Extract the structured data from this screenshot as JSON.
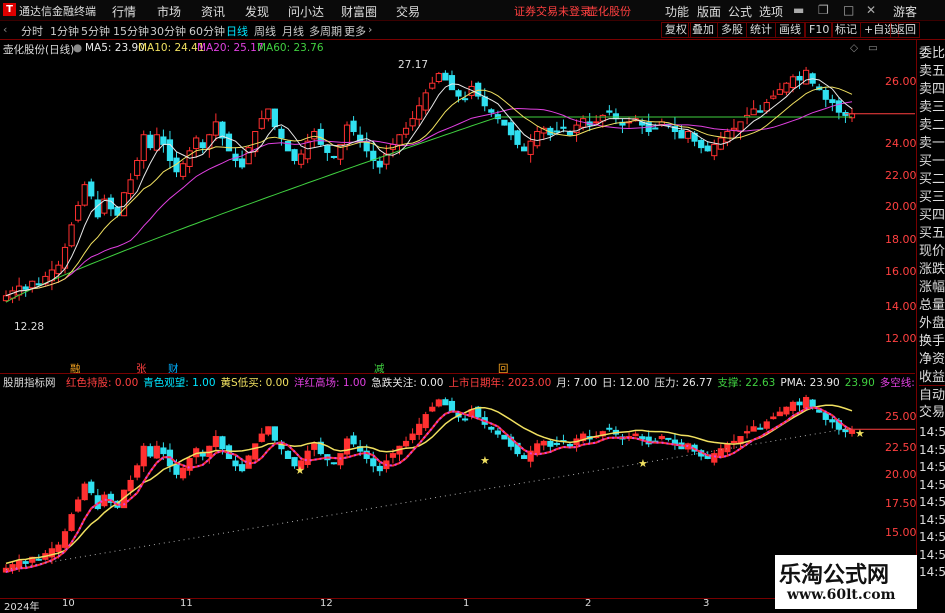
{
  "app": {
    "title": "通达信金融终端",
    "menu": [
      "行情",
      "市场",
      "资讯",
      "发现",
      "问小达",
      "财富圈",
      "交易"
    ],
    "login_notice": "证券交易未登录",
    "stock_short": "壶化股份",
    "right_menu": [
      "功能",
      "版面",
      "公式",
      "选项"
    ],
    "user": "游客"
  },
  "toolbar": {
    "periods": [
      "分时",
      "1分钟",
      "5分钟",
      "15分钟",
      "30分钟",
      "60分钟",
      "日线",
      "周线",
      "月线",
      "多周期",
      "更多"
    ],
    "active_period": "日线",
    "right_buttons": [
      "复权",
      "叠加",
      "多股",
      "统计",
      "画线",
      "F10",
      "标记",
      "+自选",
      "返回"
    ]
  },
  "main": {
    "title": "壶化股份(日线)",
    "ma": [
      {
        "label": "MA5: 23.90",
        "color": "#e8e8e8"
      },
      {
        "label": "MA10: 24.41",
        "color": "#f0e060"
      },
      {
        "label": "MA20: 25.17",
        "color": "#e040e0"
      },
      {
        "label": "MA60: 23.76",
        "color": "#40d040"
      }
    ],
    "y_ticks": [
      "26.00",
      "24.00",
      "22.00",
      "20.00",
      "18.00",
      "16.00",
      "14.00",
      "12.00"
    ],
    "high_label": "27.17",
    "low_label": "12.28",
    "event_markers": [
      "融",
      "张",
      "财",
      "减",
      "回"
    ]
  },
  "indicator": {
    "name": "股朋指标网",
    "items": [
      {
        "label": "红色持股: 0.00",
        "color": "#ff4040"
      },
      {
        "label": "青色观望: 1.00",
        "color": "#00e5ff"
      },
      {
        "label": "黄S低买: 0.00",
        "color": "#f0e060"
      },
      {
        "label": "洋红高场: 1.00",
        "color": "#e040e0"
      },
      {
        "label": "急跌关注: 0.00",
        "color": "#e8e8e8"
      },
      {
        "label": "上市日期年: 2023.00",
        "color": "#ff4040"
      },
      {
        "label": "月: 7.00",
        "color": "#e8e8e8"
      },
      {
        "label": "日: 12.00",
        "color": "#e8e8e8"
      },
      {
        "label": "压力: 26.77",
        "color": "#e8e8e8"
      },
      {
        "label": "支撑: 22.63",
        "color": "#40d040"
      },
      {
        "label": "PMA: 23.90",
        "color": "#e8e8e8"
      },
      {
        "label": "23.90",
        "color": "#40d040"
      },
      {
        "label": "多空线: 24.84",
        "color": "#e040e0"
      },
      {
        "label": "24.84",
        "color": "#e8e8e8"
      }
    ],
    "y_ticks": [
      "25.00",
      "22.50",
      "20.00",
      "17.50",
      "15.00"
    ]
  },
  "right_panel": {
    "items": [
      "委比",
      "卖五",
      "卖四",
      "卖三",
      "卖二",
      "卖一",
      "买一",
      "买二",
      "买三",
      "买四",
      "买五",
      "现价",
      "涨跌",
      "涨幅",
      "总量",
      "外盘",
      "换手",
      "净资",
      "收益"
    ],
    "tabs": [
      "自动",
      "交易"
    ],
    "times": [
      "14:54",
      "14:54",
      "14:54",
      "14:55",
      "14:55",
      "14:55",
      "14:56",
      "14:56",
      "14:56"
    ]
  },
  "dates": [
    "2024年",
    "10",
    "11",
    "12",
    "1",
    "2",
    "3"
  ],
  "watermark": {
    "line1": "乐淘公式网",
    "line2": "www.60lt.com"
  },
  "chart_data": {
    "type": "candlestick",
    "title": "壶化股份(日线)",
    "ylim": [
      11,
      27.5
    ],
    "y_ticks": [
      12,
      14,
      16,
      18,
      20,
      22,
      24,
      26
    ],
    "x_labels": [
      "2024年",
      "10",
      "11",
      "12",
      "1",
      "2",
      "3"
    ],
    "series": [
      {
        "name": "MA5",
        "values_last": 23.9
      },
      {
        "name": "MA10",
        "values_last": 24.41
      },
      {
        "name": "MA20",
        "values_last": 25.17
      },
      {
        "name": "MA60",
        "values_last": 23.76
      }
    ],
    "closes": [
      12.6,
      12.9,
      13.2,
      13.0,
      13.5,
      13.3,
      13.8,
      14.2,
      14.5,
      15.6,
      17.0,
      18.2,
      19.5,
      18.8,
      17.5,
      18.6,
      18.0,
      17.6,
      19.0,
      19.8,
      21.0,
      22.6,
      21.8,
      22.6,
      22.0,
      21.0,
      20.3,
      20.8,
      21.6,
      22.4,
      21.8,
      22.6,
      23.4,
      22.4,
      21.6,
      21.0,
      20.6,
      21.8,
      22.8,
      23.6,
      24.2,
      23.1,
      22.4,
      21.6,
      21.0,
      21.4,
      22.2,
      22.8,
      22.0,
      21.5,
      21.2,
      22.0,
      23.2,
      22.8,
      22.2,
      21.6,
      21.0,
      20.6,
      21.4,
      22.0,
      22.6,
      23.0,
      23.6,
      24.4,
      25.2,
      25.8,
      26.4,
      26.0,
      25.4,
      25.0,
      24.8,
      25.6,
      25.0,
      24.4,
      24.0,
      23.6,
      23.2,
      22.6,
      22.0,
      21.6,
      22.2,
      22.8,
      23.0,
      22.6,
      22.8,
      23.0,
      22.6,
      23.2,
      23.6,
      23.2,
      23.4,
      23.8,
      24.0,
      23.6,
      23.2,
      23.4,
      23.6,
      23.2,
      22.8,
      23.0,
      23.4,
      23.2,
      22.8,
      22.4,
      22.8,
      22.2,
      21.8,
      21.6,
      22.0,
      22.4,
      22.8,
      23.0,
      23.4,
      23.8,
      24.2,
      24.0,
      24.6,
      25.0,
      25.4,
      25.8,
      26.2,
      26.0,
      26.6,
      25.8,
      25.4,
      24.8,
      24.6,
      24.0,
      23.8,
      23.9
    ]
  }
}
